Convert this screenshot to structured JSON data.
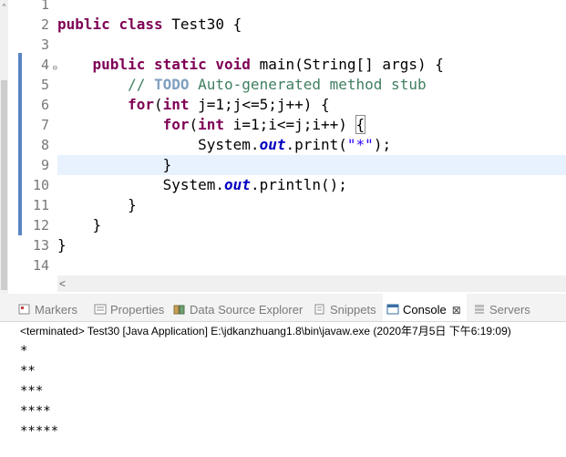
{
  "editor": {
    "line_numbers": [
      "1",
      "2",
      "3",
      "4",
      "5",
      "6",
      "7",
      "8",
      "9",
      "10",
      "11",
      "12",
      "13",
      "14"
    ],
    "current_line": 9,
    "horizontal_scroll_arrow": "<"
  },
  "console": {
    "tabs": [
      {
        "label": "Markers",
        "icon": "markers-icon",
        "active": false
      },
      {
        "label": "Properties",
        "icon": "properties-icon",
        "active": false
      },
      {
        "label": "Data Source Explorer",
        "icon": "data-source-icon",
        "active": false
      },
      {
        "label": "Snippets",
        "icon": "snippets-icon",
        "active": false
      },
      {
        "label": "Console",
        "icon": "console-icon",
        "active": true,
        "close": "⊠"
      },
      {
        "label": "Servers",
        "icon": "servers-icon",
        "active": false
      }
    ],
    "status": "<terminated> Test30 [Java Application] E:\\jdkanzhuang1.8\\bin\\javaw.exe (2020年7月5日 下午6:19:09)",
    "output": [
      "*",
      "**",
      "***",
      "****",
      "*****"
    ]
  }
}
